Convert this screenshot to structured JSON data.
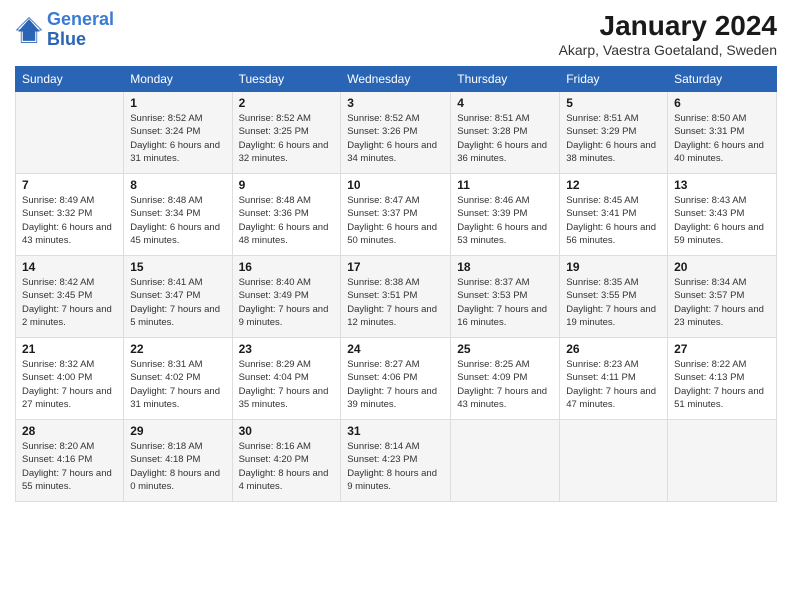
{
  "logo": {
    "line1": "General",
    "line2": "Blue"
  },
  "title": "January 2024",
  "location": "Akarp, Vaestra Goetaland, Sweden",
  "days_of_week": [
    "Sunday",
    "Monday",
    "Tuesday",
    "Wednesday",
    "Thursday",
    "Friday",
    "Saturday"
  ],
  "weeks": [
    [
      {
        "day": "",
        "sunrise": "",
        "sunset": "",
        "daylight": ""
      },
      {
        "day": "1",
        "sunrise": "Sunrise: 8:52 AM",
        "sunset": "Sunset: 3:24 PM",
        "daylight": "Daylight: 6 hours and 31 minutes."
      },
      {
        "day": "2",
        "sunrise": "Sunrise: 8:52 AM",
        "sunset": "Sunset: 3:25 PM",
        "daylight": "Daylight: 6 hours and 32 minutes."
      },
      {
        "day": "3",
        "sunrise": "Sunrise: 8:52 AM",
        "sunset": "Sunset: 3:26 PM",
        "daylight": "Daylight: 6 hours and 34 minutes."
      },
      {
        "day": "4",
        "sunrise": "Sunrise: 8:51 AM",
        "sunset": "Sunset: 3:28 PM",
        "daylight": "Daylight: 6 hours and 36 minutes."
      },
      {
        "day": "5",
        "sunrise": "Sunrise: 8:51 AM",
        "sunset": "Sunset: 3:29 PM",
        "daylight": "Daylight: 6 hours and 38 minutes."
      },
      {
        "day": "6",
        "sunrise": "Sunrise: 8:50 AM",
        "sunset": "Sunset: 3:31 PM",
        "daylight": "Daylight: 6 hours and 40 minutes."
      }
    ],
    [
      {
        "day": "7",
        "sunrise": "Sunrise: 8:49 AM",
        "sunset": "Sunset: 3:32 PM",
        "daylight": "Daylight: 6 hours and 43 minutes."
      },
      {
        "day": "8",
        "sunrise": "Sunrise: 8:48 AM",
        "sunset": "Sunset: 3:34 PM",
        "daylight": "Daylight: 6 hours and 45 minutes."
      },
      {
        "day": "9",
        "sunrise": "Sunrise: 8:48 AM",
        "sunset": "Sunset: 3:36 PM",
        "daylight": "Daylight: 6 hours and 48 minutes."
      },
      {
        "day": "10",
        "sunrise": "Sunrise: 8:47 AM",
        "sunset": "Sunset: 3:37 PM",
        "daylight": "Daylight: 6 hours and 50 minutes."
      },
      {
        "day": "11",
        "sunrise": "Sunrise: 8:46 AM",
        "sunset": "Sunset: 3:39 PM",
        "daylight": "Daylight: 6 hours and 53 minutes."
      },
      {
        "day": "12",
        "sunrise": "Sunrise: 8:45 AM",
        "sunset": "Sunset: 3:41 PM",
        "daylight": "Daylight: 6 hours and 56 minutes."
      },
      {
        "day": "13",
        "sunrise": "Sunrise: 8:43 AM",
        "sunset": "Sunset: 3:43 PM",
        "daylight": "Daylight: 6 hours and 59 minutes."
      }
    ],
    [
      {
        "day": "14",
        "sunrise": "Sunrise: 8:42 AM",
        "sunset": "Sunset: 3:45 PM",
        "daylight": "Daylight: 7 hours and 2 minutes."
      },
      {
        "day": "15",
        "sunrise": "Sunrise: 8:41 AM",
        "sunset": "Sunset: 3:47 PM",
        "daylight": "Daylight: 7 hours and 5 minutes."
      },
      {
        "day": "16",
        "sunrise": "Sunrise: 8:40 AM",
        "sunset": "Sunset: 3:49 PM",
        "daylight": "Daylight: 7 hours and 9 minutes."
      },
      {
        "day": "17",
        "sunrise": "Sunrise: 8:38 AM",
        "sunset": "Sunset: 3:51 PM",
        "daylight": "Daylight: 7 hours and 12 minutes."
      },
      {
        "day": "18",
        "sunrise": "Sunrise: 8:37 AM",
        "sunset": "Sunset: 3:53 PM",
        "daylight": "Daylight: 7 hours and 16 minutes."
      },
      {
        "day": "19",
        "sunrise": "Sunrise: 8:35 AM",
        "sunset": "Sunset: 3:55 PM",
        "daylight": "Daylight: 7 hours and 19 minutes."
      },
      {
        "day": "20",
        "sunrise": "Sunrise: 8:34 AM",
        "sunset": "Sunset: 3:57 PM",
        "daylight": "Daylight: 7 hours and 23 minutes."
      }
    ],
    [
      {
        "day": "21",
        "sunrise": "Sunrise: 8:32 AM",
        "sunset": "Sunset: 4:00 PM",
        "daylight": "Daylight: 7 hours and 27 minutes."
      },
      {
        "day": "22",
        "sunrise": "Sunrise: 8:31 AM",
        "sunset": "Sunset: 4:02 PM",
        "daylight": "Daylight: 7 hours and 31 minutes."
      },
      {
        "day": "23",
        "sunrise": "Sunrise: 8:29 AM",
        "sunset": "Sunset: 4:04 PM",
        "daylight": "Daylight: 7 hours and 35 minutes."
      },
      {
        "day": "24",
        "sunrise": "Sunrise: 8:27 AM",
        "sunset": "Sunset: 4:06 PM",
        "daylight": "Daylight: 7 hours and 39 minutes."
      },
      {
        "day": "25",
        "sunrise": "Sunrise: 8:25 AM",
        "sunset": "Sunset: 4:09 PM",
        "daylight": "Daylight: 7 hours and 43 minutes."
      },
      {
        "day": "26",
        "sunrise": "Sunrise: 8:23 AM",
        "sunset": "Sunset: 4:11 PM",
        "daylight": "Daylight: 7 hours and 47 minutes."
      },
      {
        "day": "27",
        "sunrise": "Sunrise: 8:22 AM",
        "sunset": "Sunset: 4:13 PM",
        "daylight": "Daylight: 7 hours and 51 minutes."
      }
    ],
    [
      {
        "day": "28",
        "sunrise": "Sunrise: 8:20 AM",
        "sunset": "Sunset: 4:16 PM",
        "daylight": "Daylight: 7 hours and 55 minutes."
      },
      {
        "day": "29",
        "sunrise": "Sunrise: 8:18 AM",
        "sunset": "Sunset: 4:18 PM",
        "daylight": "Daylight: 8 hours and 0 minutes."
      },
      {
        "day": "30",
        "sunrise": "Sunrise: 8:16 AM",
        "sunset": "Sunset: 4:20 PM",
        "daylight": "Daylight: 8 hours and 4 minutes."
      },
      {
        "day": "31",
        "sunrise": "Sunrise: 8:14 AM",
        "sunset": "Sunset: 4:23 PM",
        "daylight": "Daylight: 8 hours and 9 minutes."
      },
      {
        "day": "",
        "sunrise": "",
        "sunset": "",
        "daylight": ""
      },
      {
        "day": "",
        "sunrise": "",
        "sunset": "",
        "daylight": ""
      },
      {
        "day": "",
        "sunrise": "",
        "sunset": "",
        "daylight": ""
      }
    ]
  ]
}
